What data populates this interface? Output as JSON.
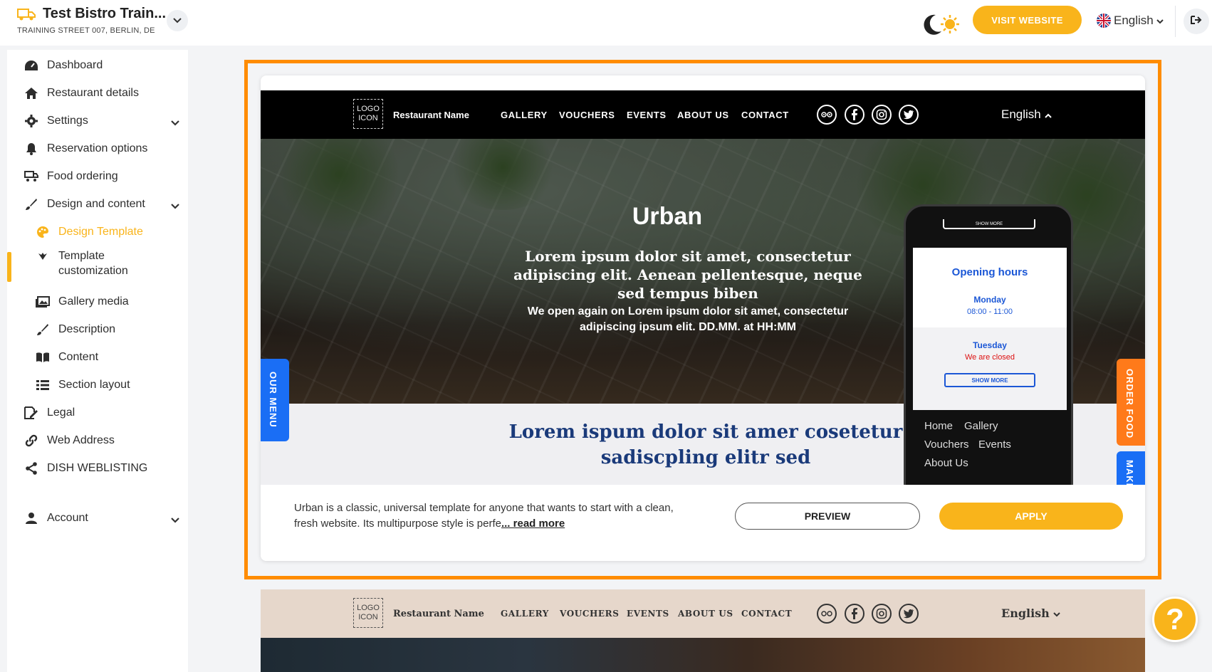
{
  "header": {
    "restaurant_name": "Test Bistro Train...",
    "address": "TRAINING STREET 007, BERLIN, DE",
    "visit_website": "VISIT WEBSITE",
    "language": "English"
  },
  "sidebar": {
    "items": [
      {
        "label": "Dashboard"
      },
      {
        "label": "Restaurant details"
      },
      {
        "label": "Settings"
      },
      {
        "label": "Reservation options"
      },
      {
        "label": "Food ordering"
      },
      {
        "label": "Design and content"
      },
      {
        "label": "Design Template"
      },
      {
        "label": "Template customization"
      },
      {
        "label": "Gallery media"
      },
      {
        "label": "Description"
      },
      {
        "label": "Content"
      },
      {
        "label": "Section layout"
      },
      {
        "label": "Legal"
      },
      {
        "label": "Web Address"
      },
      {
        "label": "DISH WEBLISTING"
      },
      {
        "label": "Account"
      }
    ],
    "active_color": "#f9b41b"
  },
  "template": {
    "site_nav": {
      "logo": "LOGO ICON",
      "restaurant_name": "Restaurant Name",
      "links": [
        "GALLERY",
        "VOUCHERS",
        "EVENTS",
        "ABOUT US",
        "CONTACT"
      ],
      "language": "English"
    },
    "hero": {
      "title": "Urban",
      "text": "Lorem ipsum dolor sit amet, consectetur adipiscing elit. Aenean pellentesque, neque sed tempus biben",
      "subtext": "We open again on Lorem ipsum dolor sit amet, consectetur adipiscing ipsum elit. DD.MM. at HH:MM"
    },
    "heading": "Lorem ispum dolor sit amer cosetetur sadiscpling elitr sed",
    "tabs": {
      "our_menu": "OUR MENU",
      "order_food": "ORDER FOOD",
      "make": "MAKE"
    },
    "phone": {
      "top_button": "SHOW MORE",
      "opening_hours": "Opening hours",
      "day1": "Monday",
      "time1": "08:00 - 11:00",
      "day2": "Tuesday",
      "closed": "We are closed",
      "show_more": "SHOW MORE",
      "links": [
        "Home",
        "Gallery",
        "Vouchers",
        "Events",
        "About Us"
      ]
    },
    "description": "Urban is a classic, universal template for anyone that wants to start with a clean, fresh website. Its multipurpose style is perfe",
    "read_more": "... read more",
    "preview_label": "PREVIEW",
    "apply_label": "APPLY"
  },
  "template2": {
    "logo": "LOGO ICON",
    "restaurant_name": "Restaurant Name",
    "links": [
      "GALLERY",
      "VOUCHERS",
      "EVENTS",
      "ABOUT US",
      "CONTACT"
    ],
    "language": "English"
  },
  "help": "?",
  "colors": {
    "accent": "#f9b41b",
    "highlight_border": "#ff8c00",
    "template_blue": "#1b57d6",
    "order_tab": "#ff7a1a"
  }
}
